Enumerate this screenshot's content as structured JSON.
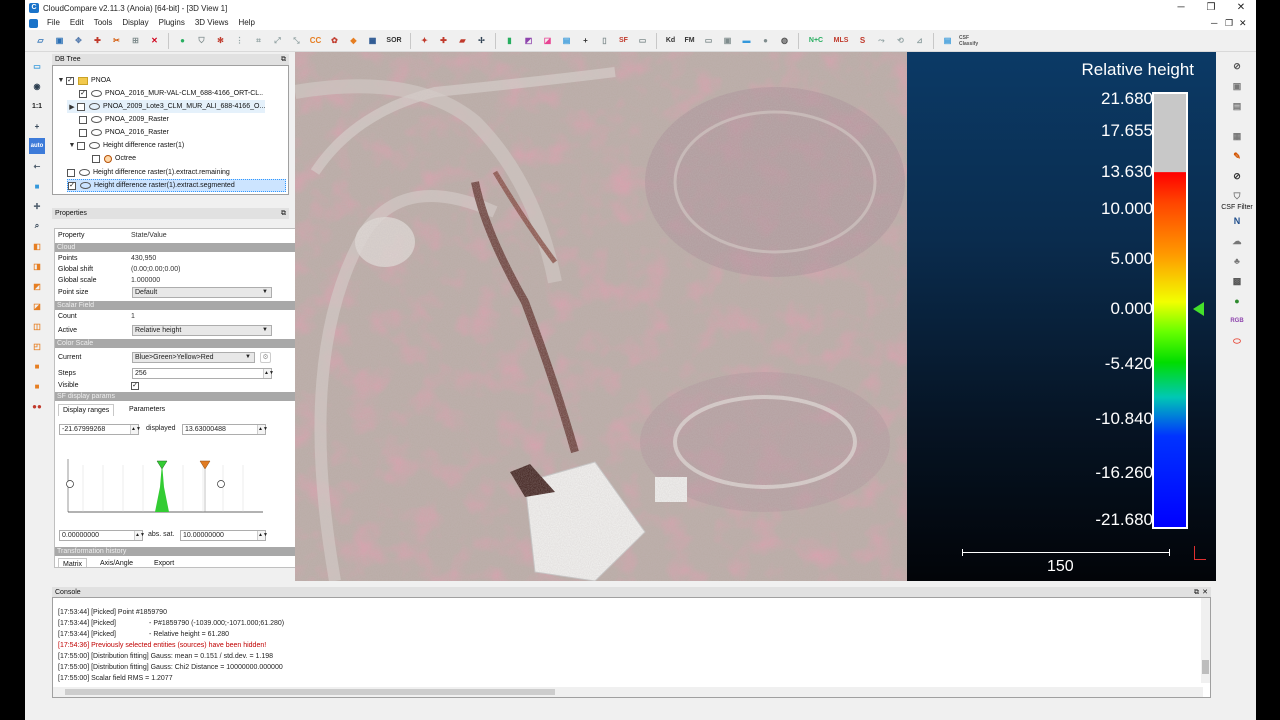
{
  "window": {
    "title": "CloudCompare v2.11.3 (Anoia) [64-bit] - [3D View 1]",
    "minimize": "─",
    "restore": "❐",
    "close": "✕"
  },
  "menu": {
    "items": [
      "File",
      "Edit",
      "Tools",
      "Display",
      "Plugins",
      "3D Views",
      "Help"
    ]
  },
  "toolbar": {
    "icons": [
      "SOR",
      "SF",
      "Kd",
      "FM",
      "N+C",
      "MLS",
      "CSF Classify"
    ]
  },
  "lefttools": {
    "one_to_one": "1:1",
    "auto": "auto"
  },
  "dbtree": {
    "header": "DB Tree",
    "items": [
      {
        "label": "PNOA",
        "checked": true
      },
      {
        "label": "PNOA_2016_MUR-VAL-CLM_688-4166_ORT-CL..",
        "checked": true
      },
      {
        "label": "PNOA_2009_Lote3_CLM_MUR_ALI_688-4166_O...",
        "checked": false
      },
      {
        "label": "PNOA_2009_Raster",
        "checked": false
      },
      {
        "label": "PNOA_2016_Raster",
        "checked": false
      },
      {
        "label": "Height difference raster(1)",
        "checked": false
      },
      {
        "label": "Octree",
        "checked": false
      },
      {
        "label": "Height difference raster(1).extract.remaining",
        "checked": false
      },
      {
        "label": "Height difference raster(1).extract.segmented",
        "checked": true
      }
    ]
  },
  "properties": {
    "header": "Properties",
    "col_property": "Property",
    "col_value": "State/Value",
    "sec_cloud": "Cloud",
    "points_label": "Points",
    "points_value": "430,950",
    "shift_label": "Global shift",
    "shift_value": "(0.00;0.00;0.00)",
    "scale_label": "Global scale",
    "scale_value": "1.000000",
    "pointsize_label": "Point size",
    "pointsize_value": "Default",
    "sec_sf": "Scalar Field",
    "count_label": "Count",
    "count_value": "1",
    "active_label": "Active",
    "active_value": "Relative height",
    "sec_colorscale": "Color Scale",
    "current_label": "Current",
    "current_value": "Blue>Green>Yellow>Red",
    "steps_label": "Steps",
    "steps_value": "256",
    "visible_label": "Visible",
    "visible_value": "✓",
    "sec_sfdisplay": "SF display params",
    "tab_display": "Display ranges",
    "tab_params": "Parameters",
    "range_min": "-21.67999268",
    "displayed_label": "displayed",
    "displayed_max": "13.63000488",
    "sat_min": "0.00000000",
    "sat_label": "abs. sat.",
    "sat_max": "10.00000000",
    "sec_transform": "Transformation history",
    "tab_matrix": "Matrix",
    "tab_axis": "Axis/Angle",
    "tab_export": "Export"
  },
  "colorscale": {
    "title": "Relative height",
    "ticks": [
      "21.680",
      "17.655",
      "13.630",
      "10.000",
      "5.000",
      "0.000",
      "-5.420",
      "-10.840",
      "-16.260",
      "-21.680"
    ],
    "scale_value": "150",
    "colors": {
      "top_gray": "#c8c8c8",
      "red": "#ff0000",
      "yellow": "#f2ff00",
      "green": "#00dd00",
      "blue": "#0000ff",
      "cursor": "#44e02a"
    }
  },
  "righttools": {
    "csf_label": "CSF Filter",
    "n_label": "N",
    "rgb_label": "RGB"
  },
  "console": {
    "header": "Console",
    "lines": [
      {
        "text": "[17:53:44] [Picked] Point #1859790",
        "warn": false
      },
      {
        "text": "[17:53:44] [Picked]                 - P#1859790 (-1039.000;-1071.000;61.280)",
        "warn": false
      },
      {
        "text": "[17:53:44] [Picked]                 - Relative height = 61.280",
        "warn": false
      },
      {
        "text": "[17:54:36] Previously selected entities (sources) have been hidden!",
        "warn": true
      },
      {
        "text": "[17:55:00] [Distribution fitting] Gauss: mean = 0.151 / std.dev. = 1.198",
        "warn": false
      },
      {
        "text": "[17:55:00] [Distribution fitting] Gauss: Chi2 Distance = 10000000.000000",
        "warn": false
      },
      {
        "text": "[17:55:00] Scalar field RMS = 1.2077",
        "warn": false
      }
    ]
  }
}
